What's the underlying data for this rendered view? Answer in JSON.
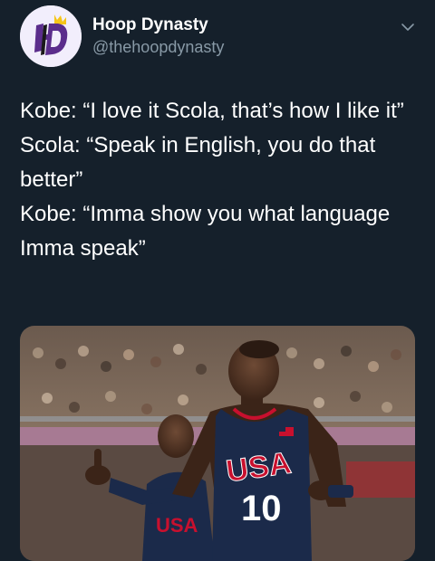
{
  "author": {
    "display_name": "Hoop Dynasty",
    "handle": "@thehoopdynasty",
    "avatar_icon": "hoop-dynasty-logo",
    "avatar_bg": "#f2eefc",
    "logo_purple": "#5b2d8c",
    "logo_gold": "#f5c518"
  },
  "tweet": {
    "lines": [
      "Kobe: “I love it Scola, that’s how I like it”",
      "Scola: “Speak in English, you do that better”",
      "Kobe: “Imma show you what language Imma speak”"
    ]
  },
  "menu_icon": "chevron-down-icon",
  "media": {
    "description_icon": "photo",
    "jersey_text": "USA",
    "jersey_number": "10",
    "second_jersey_text": "USA",
    "jersey_color": "#1b2a4a",
    "jersey_red": "#c8102e"
  },
  "colors": {
    "background": "#15202b",
    "secondary_text": "#8899a6"
  }
}
